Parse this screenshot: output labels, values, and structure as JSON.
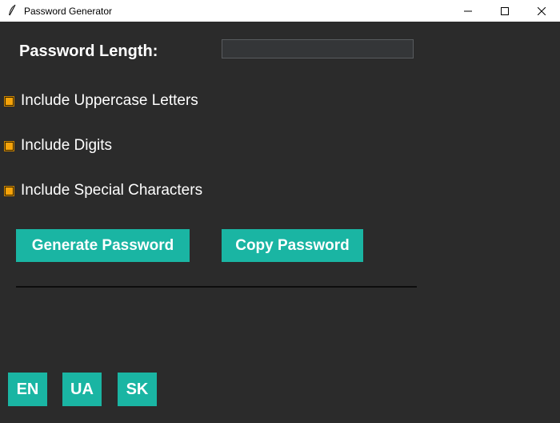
{
  "window": {
    "title": "Password Generator",
    "controls": [
      "minimize-icon",
      "maximize-icon",
      "close-icon"
    ]
  },
  "form": {
    "length_label": "Password Length:",
    "length_value": "",
    "options": [
      {
        "label": "Include Uppercase Letters",
        "checked": true
      },
      {
        "label": "Include Digits",
        "checked": true
      },
      {
        "label": "Include Special Characters",
        "checked": true
      }
    ]
  },
  "actions": {
    "generate_label": "Generate Password",
    "copy_label": "Copy Password"
  },
  "output": {
    "password": ""
  },
  "languages": [
    "EN",
    "UA",
    "SK"
  ],
  "colors": {
    "background": "#2b2b2b",
    "accent": "#1ab5a3",
    "checkbox": "#f5a30a",
    "text": "#ffffff"
  }
}
